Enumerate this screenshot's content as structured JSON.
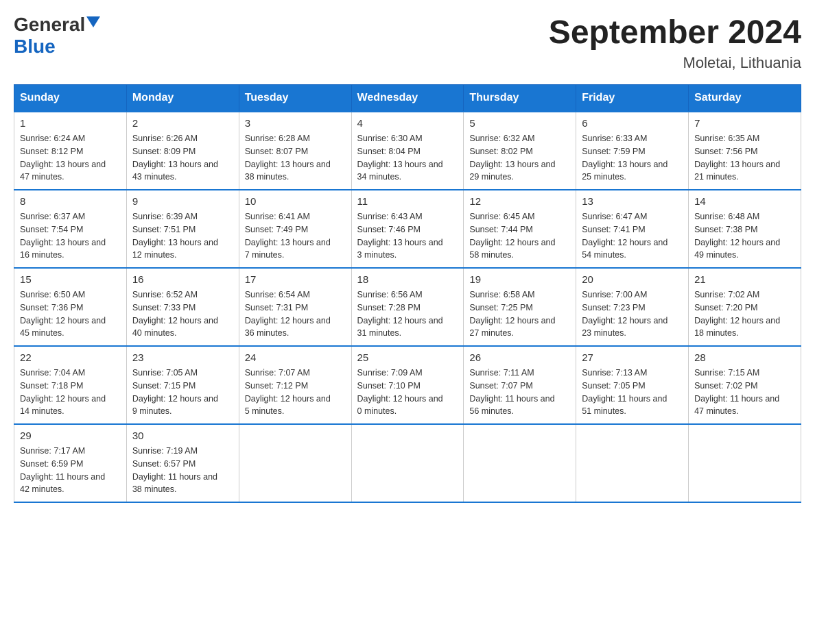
{
  "logo": {
    "general": "General",
    "blue": "Blue"
  },
  "title": "September 2024",
  "location": "Moletai, Lithuania",
  "days_of_week": [
    "Sunday",
    "Monday",
    "Tuesday",
    "Wednesday",
    "Thursday",
    "Friday",
    "Saturday"
  ],
  "weeks": [
    [
      {
        "day": "1",
        "sunrise": "6:24 AM",
        "sunset": "8:12 PM",
        "daylight": "13 hours and 47 minutes."
      },
      {
        "day": "2",
        "sunrise": "6:26 AM",
        "sunset": "8:09 PM",
        "daylight": "13 hours and 43 minutes."
      },
      {
        "day": "3",
        "sunrise": "6:28 AM",
        "sunset": "8:07 PM",
        "daylight": "13 hours and 38 minutes."
      },
      {
        "day": "4",
        "sunrise": "6:30 AM",
        "sunset": "8:04 PM",
        "daylight": "13 hours and 34 minutes."
      },
      {
        "day": "5",
        "sunrise": "6:32 AM",
        "sunset": "8:02 PM",
        "daylight": "13 hours and 29 minutes."
      },
      {
        "day": "6",
        "sunrise": "6:33 AM",
        "sunset": "7:59 PM",
        "daylight": "13 hours and 25 minutes."
      },
      {
        "day": "7",
        "sunrise": "6:35 AM",
        "sunset": "7:56 PM",
        "daylight": "13 hours and 21 minutes."
      }
    ],
    [
      {
        "day": "8",
        "sunrise": "6:37 AM",
        "sunset": "7:54 PM",
        "daylight": "13 hours and 16 minutes."
      },
      {
        "day": "9",
        "sunrise": "6:39 AM",
        "sunset": "7:51 PM",
        "daylight": "13 hours and 12 minutes."
      },
      {
        "day": "10",
        "sunrise": "6:41 AM",
        "sunset": "7:49 PM",
        "daylight": "13 hours and 7 minutes."
      },
      {
        "day": "11",
        "sunrise": "6:43 AM",
        "sunset": "7:46 PM",
        "daylight": "13 hours and 3 minutes."
      },
      {
        "day": "12",
        "sunrise": "6:45 AM",
        "sunset": "7:44 PM",
        "daylight": "12 hours and 58 minutes."
      },
      {
        "day": "13",
        "sunrise": "6:47 AM",
        "sunset": "7:41 PM",
        "daylight": "12 hours and 54 minutes."
      },
      {
        "day": "14",
        "sunrise": "6:48 AM",
        "sunset": "7:38 PM",
        "daylight": "12 hours and 49 minutes."
      }
    ],
    [
      {
        "day": "15",
        "sunrise": "6:50 AM",
        "sunset": "7:36 PM",
        "daylight": "12 hours and 45 minutes."
      },
      {
        "day": "16",
        "sunrise": "6:52 AM",
        "sunset": "7:33 PM",
        "daylight": "12 hours and 40 minutes."
      },
      {
        "day": "17",
        "sunrise": "6:54 AM",
        "sunset": "7:31 PM",
        "daylight": "12 hours and 36 minutes."
      },
      {
        "day": "18",
        "sunrise": "6:56 AM",
        "sunset": "7:28 PM",
        "daylight": "12 hours and 31 minutes."
      },
      {
        "day": "19",
        "sunrise": "6:58 AM",
        "sunset": "7:25 PM",
        "daylight": "12 hours and 27 minutes."
      },
      {
        "day": "20",
        "sunrise": "7:00 AM",
        "sunset": "7:23 PM",
        "daylight": "12 hours and 23 minutes."
      },
      {
        "day": "21",
        "sunrise": "7:02 AM",
        "sunset": "7:20 PM",
        "daylight": "12 hours and 18 minutes."
      }
    ],
    [
      {
        "day": "22",
        "sunrise": "7:04 AM",
        "sunset": "7:18 PM",
        "daylight": "12 hours and 14 minutes."
      },
      {
        "day": "23",
        "sunrise": "7:05 AM",
        "sunset": "7:15 PM",
        "daylight": "12 hours and 9 minutes."
      },
      {
        "day": "24",
        "sunrise": "7:07 AM",
        "sunset": "7:12 PM",
        "daylight": "12 hours and 5 minutes."
      },
      {
        "day": "25",
        "sunrise": "7:09 AM",
        "sunset": "7:10 PM",
        "daylight": "12 hours and 0 minutes."
      },
      {
        "day": "26",
        "sunrise": "7:11 AM",
        "sunset": "7:07 PM",
        "daylight": "11 hours and 56 minutes."
      },
      {
        "day": "27",
        "sunrise": "7:13 AM",
        "sunset": "7:05 PM",
        "daylight": "11 hours and 51 minutes."
      },
      {
        "day": "28",
        "sunrise": "7:15 AM",
        "sunset": "7:02 PM",
        "daylight": "11 hours and 47 minutes."
      }
    ],
    [
      {
        "day": "29",
        "sunrise": "7:17 AM",
        "sunset": "6:59 PM",
        "daylight": "11 hours and 42 minutes."
      },
      {
        "day": "30",
        "sunrise": "7:19 AM",
        "sunset": "6:57 PM",
        "daylight": "11 hours and 38 minutes."
      },
      null,
      null,
      null,
      null,
      null
    ]
  ],
  "labels": {
    "sunrise": "Sunrise:",
    "sunset": "Sunset:",
    "daylight": "Daylight:"
  }
}
